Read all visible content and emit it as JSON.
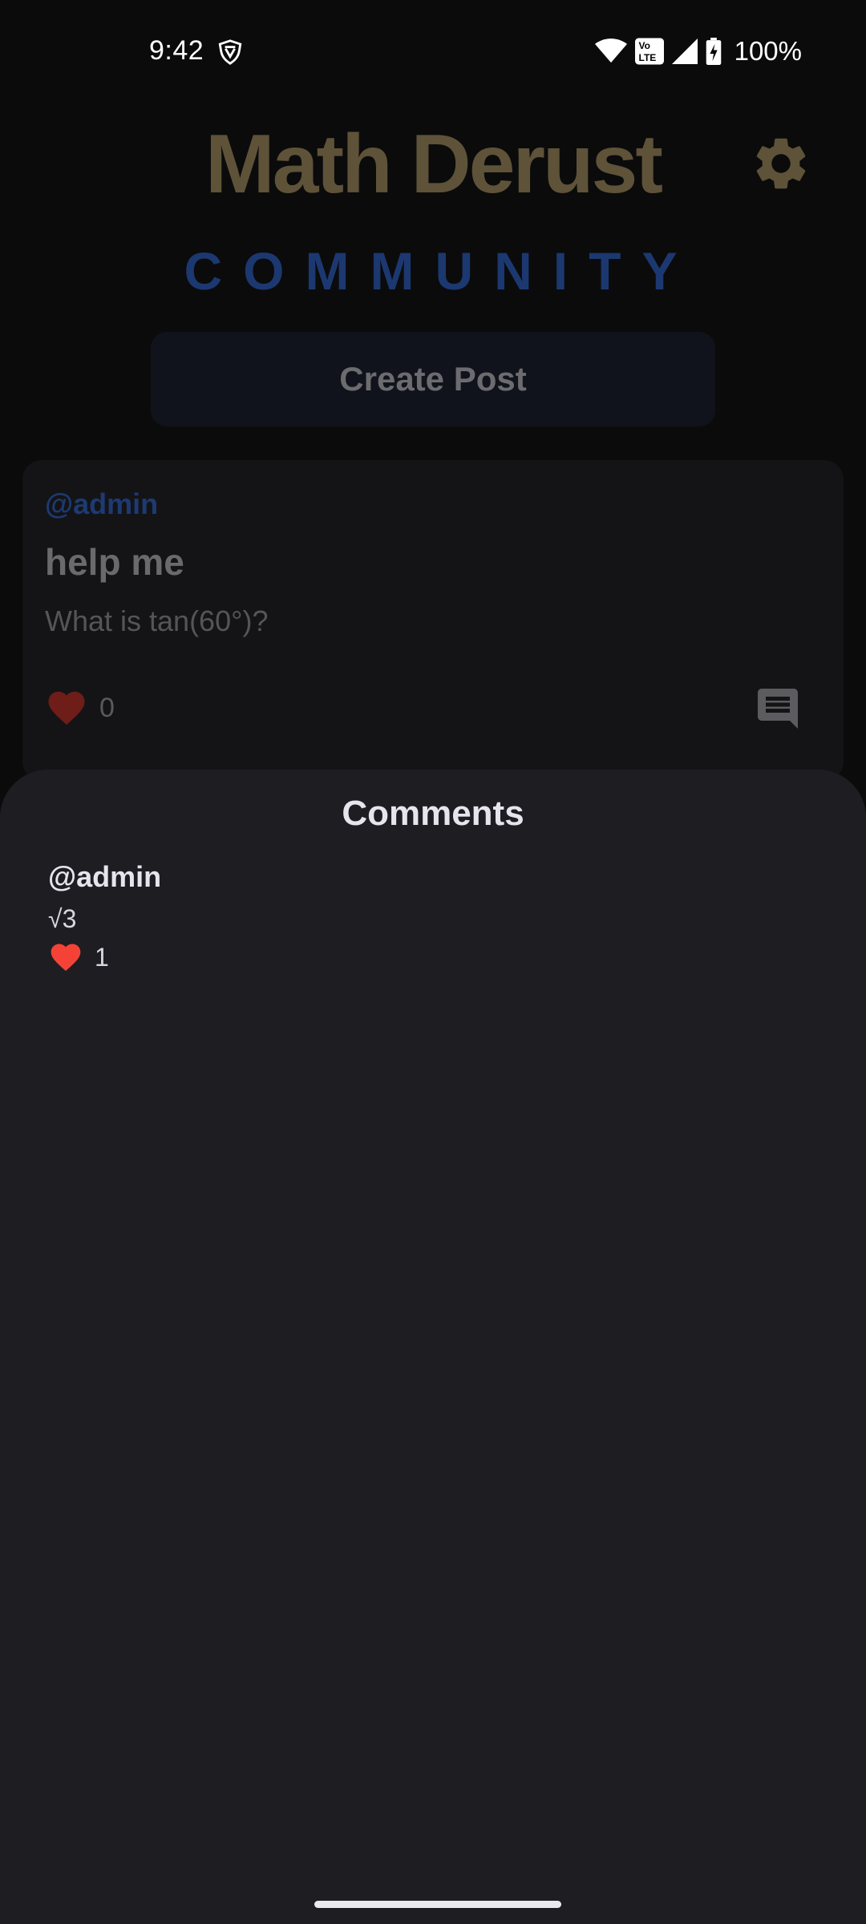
{
  "status_bar": {
    "time": "9:42",
    "battery": "100%",
    "icons": [
      "vpn-shield-icon",
      "wifi-icon",
      "volte-icon",
      "cell-signal-icon",
      "battery-charging-icon"
    ]
  },
  "header": {
    "title": "Math Derust",
    "subtitle": "COMMUNITY",
    "settings_icon": "gear-icon",
    "title_color": "#5e5238",
    "subtitle_color": "#1c3870"
  },
  "create_post": {
    "label": "Create Post"
  },
  "post": {
    "author": "@admin",
    "title": "help me",
    "body": "What is tan(60°)?",
    "like_count": "0",
    "like_icon": "heart-icon",
    "comment_icon": "comment-icon"
  },
  "comments_sheet": {
    "title": "Comments",
    "comments": [
      {
        "author": "@admin",
        "text": "√3",
        "like_count": "1",
        "like_icon": "heart-icon",
        "like_color": "#f44336"
      }
    ]
  }
}
